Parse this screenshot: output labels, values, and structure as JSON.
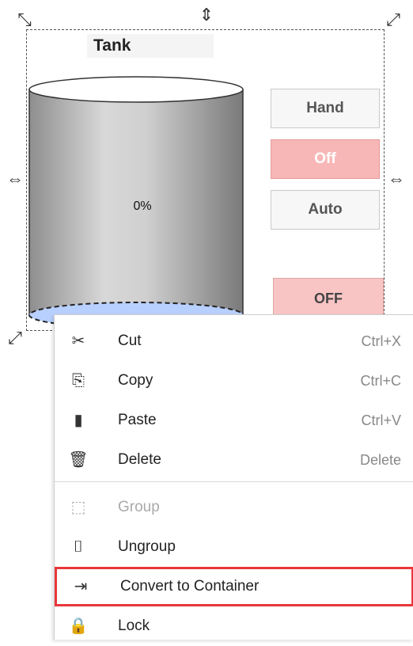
{
  "tank": {
    "title": "Tank",
    "level_text": "0%",
    "level": 0
  },
  "mode_buttons": [
    {
      "label": "Hand",
      "active": false
    },
    {
      "label": "Off",
      "active": true
    },
    {
      "label": "Auto",
      "active": false
    }
  ],
  "status_button": {
    "label": "OFF"
  },
  "context_menu": {
    "items": [
      {
        "label": "Cut",
        "shortcut": "Ctrl+X",
        "icon": "scissors-icon"
      },
      {
        "label": "Copy",
        "shortcut": "Ctrl+C",
        "icon": "copy-icon"
      },
      {
        "label": "Paste",
        "shortcut": "Ctrl+V",
        "icon": "clipboard-icon"
      },
      {
        "label": "Delete",
        "shortcut": "Delete",
        "icon": "trash-icon"
      },
      {
        "label": "Group",
        "shortcut": "",
        "icon": "group-icon",
        "disabled": true
      },
      {
        "label": "Ungroup",
        "shortcut": "",
        "icon": "ungroup-icon"
      },
      {
        "label": "Convert to Container",
        "shortcut": "",
        "icon": "container-icon",
        "highlighted": true
      },
      {
        "label": "Lock",
        "shortcut": "",
        "icon": "lock-icon"
      }
    ]
  },
  "colors": {
    "highlight_border": "#e8373b",
    "active_button": "#f8b7b7",
    "tank_fill_bottom": "#b8d0ff"
  }
}
